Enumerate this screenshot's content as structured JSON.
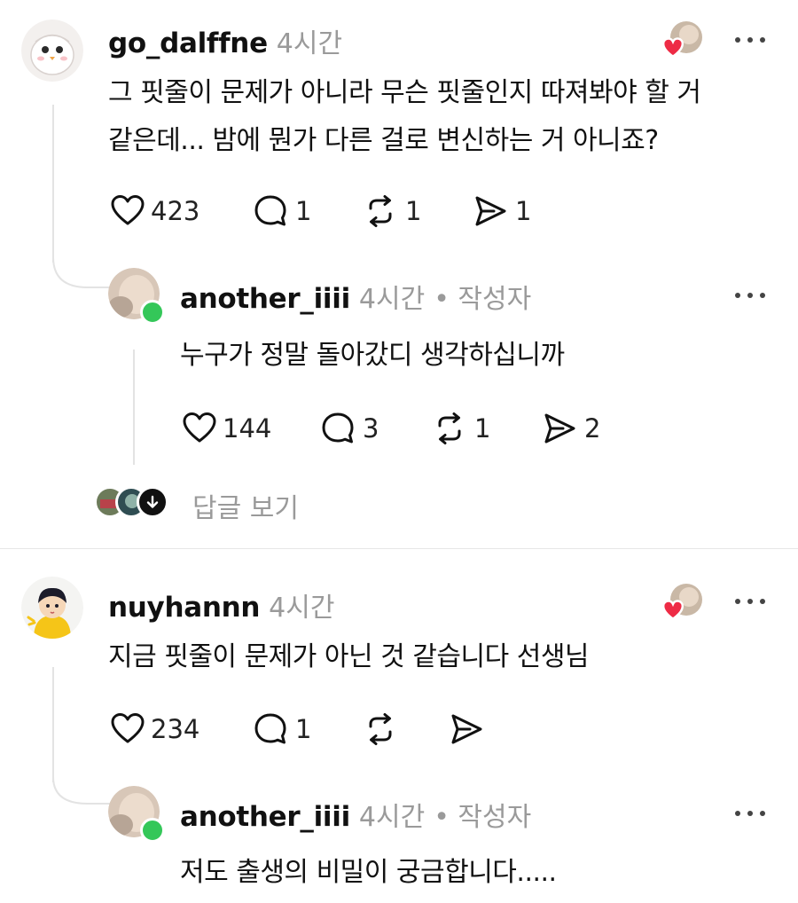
{
  "colors": {
    "accent_online": "#34c759",
    "like_heart": "#ee2b45",
    "muted": "#9a9a9a",
    "divider": "#e6e6e6"
  },
  "comments": [
    {
      "username": "go_dalffne",
      "time": "4시간",
      "text_line1": "그 핏줄이 문제가 아니라 무슨 핏줄인지 따져봐야 할 거",
      "text_line2": "같은데... 밤에 뭔가 다른 걸로 변신하는 거 아니죠?",
      "likes": "423",
      "replies": "1",
      "reposts": "1",
      "shares": "1",
      "reply": {
        "username": "another_iiii",
        "time": "4시간",
        "author_tag": "• 작성자",
        "text": "누구가 정말 돌아갔디 생각하십니까",
        "likes": "144",
        "replies": "3",
        "reposts": "1",
        "shares": "2"
      },
      "view_replies": "답글 보기"
    },
    {
      "username": "nuyhannn",
      "time": "4시간",
      "text": "지금 핏줄이 문제가 아닌 것 같습니다 선생님",
      "likes": "234",
      "replies": "1",
      "reply": {
        "username": "another_iiii",
        "time": "4시간",
        "author_tag": "• 작성자",
        "text": "저도 출생의 비밀이 궁금합니다....."
      }
    }
  ],
  "icons": [
    "heart-icon",
    "comment-icon",
    "repost-icon",
    "share-icon",
    "more-icon",
    "down-arrow-icon"
  ]
}
